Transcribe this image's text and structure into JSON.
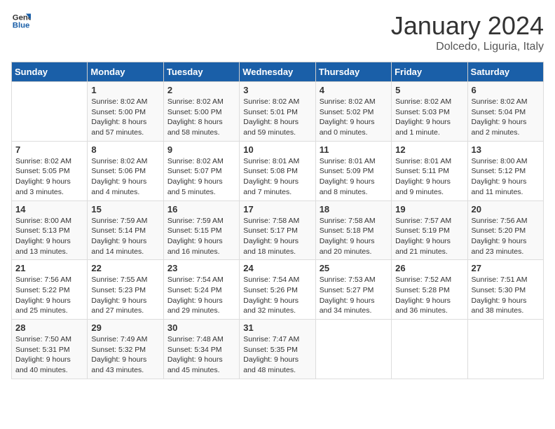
{
  "logo": {
    "line1": "General",
    "line2": "Blue"
  },
  "header": {
    "month": "January 2024",
    "location": "Dolcedo, Liguria, Italy"
  },
  "weekdays": [
    "Sunday",
    "Monday",
    "Tuesday",
    "Wednesday",
    "Thursday",
    "Friday",
    "Saturday"
  ],
  "weeks": [
    [
      {
        "day": "",
        "info": ""
      },
      {
        "day": "1",
        "info": "Sunrise: 8:02 AM\nSunset: 5:00 PM\nDaylight: 8 hours\nand 57 minutes."
      },
      {
        "day": "2",
        "info": "Sunrise: 8:02 AM\nSunset: 5:00 PM\nDaylight: 8 hours\nand 58 minutes."
      },
      {
        "day": "3",
        "info": "Sunrise: 8:02 AM\nSunset: 5:01 PM\nDaylight: 8 hours\nand 59 minutes."
      },
      {
        "day": "4",
        "info": "Sunrise: 8:02 AM\nSunset: 5:02 PM\nDaylight: 9 hours\nand 0 minutes."
      },
      {
        "day": "5",
        "info": "Sunrise: 8:02 AM\nSunset: 5:03 PM\nDaylight: 9 hours\nand 1 minute."
      },
      {
        "day": "6",
        "info": "Sunrise: 8:02 AM\nSunset: 5:04 PM\nDaylight: 9 hours\nand 2 minutes."
      }
    ],
    [
      {
        "day": "7",
        "info": "Sunrise: 8:02 AM\nSunset: 5:05 PM\nDaylight: 9 hours\nand 3 minutes."
      },
      {
        "day": "8",
        "info": "Sunrise: 8:02 AM\nSunset: 5:06 PM\nDaylight: 9 hours\nand 4 minutes."
      },
      {
        "day": "9",
        "info": "Sunrise: 8:02 AM\nSunset: 5:07 PM\nDaylight: 9 hours\nand 5 minutes."
      },
      {
        "day": "10",
        "info": "Sunrise: 8:01 AM\nSunset: 5:08 PM\nDaylight: 9 hours\nand 7 minutes."
      },
      {
        "day": "11",
        "info": "Sunrise: 8:01 AM\nSunset: 5:09 PM\nDaylight: 9 hours\nand 8 minutes."
      },
      {
        "day": "12",
        "info": "Sunrise: 8:01 AM\nSunset: 5:11 PM\nDaylight: 9 hours\nand 9 minutes."
      },
      {
        "day": "13",
        "info": "Sunrise: 8:00 AM\nSunset: 5:12 PM\nDaylight: 9 hours\nand 11 minutes."
      }
    ],
    [
      {
        "day": "14",
        "info": "Sunrise: 8:00 AM\nSunset: 5:13 PM\nDaylight: 9 hours\nand 13 minutes."
      },
      {
        "day": "15",
        "info": "Sunrise: 7:59 AM\nSunset: 5:14 PM\nDaylight: 9 hours\nand 14 minutes."
      },
      {
        "day": "16",
        "info": "Sunrise: 7:59 AM\nSunset: 5:15 PM\nDaylight: 9 hours\nand 16 minutes."
      },
      {
        "day": "17",
        "info": "Sunrise: 7:58 AM\nSunset: 5:17 PM\nDaylight: 9 hours\nand 18 minutes."
      },
      {
        "day": "18",
        "info": "Sunrise: 7:58 AM\nSunset: 5:18 PM\nDaylight: 9 hours\nand 20 minutes."
      },
      {
        "day": "19",
        "info": "Sunrise: 7:57 AM\nSunset: 5:19 PM\nDaylight: 9 hours\nand 21 minutes."
      },
      {
        "day": "20",
        "info": "Sunrise: 7:56 AM\nSunset: 5:20 PM\nDaylight: 9 hours\nand 23 minutes."
      }
    ],
    [
      {
        "day": "21",
        "info": "Sunrise: 7:56 AM\nSunset: 5:22 PM\nDaylight: 9 hours\nand 25 minutes."
      },
      {
        "day": "22",
        "info": "Sunrise: 7:55 AM\nSunset: 5:23 PM\nDaylight: 9 hours\nand 27 minutes."
      },
      {
        "day": "23",
        "info": "Sunrise: 7:54 AM\nSunset: 5:24 PM\nDaylight: 9 hours\nand 29 minutes."
      },
      {
        "day": "24",
        "info": "Sunrise: 7:54 AM\nSunset: 5:26 PM\nDaylight: 9 hours\nand 32 minutes."
      },
      {
        "day": "25",
        "info": "Sunrise: 7:53 AM\nSunset: 5:27 PM\nDaylight: 9 hours\nand 34 minutes."
      },
      {
        "day": "26",
        "info": "Sunrise: 7:52 AM\nSunset: 5:28 PM\nDaylight: 9 hours\nand 36 minutes."
      },
      {
        "day": "27",
        "info": "Sunrise: 7:51 AM\nSunset: 5:30 PM\nDaylight: 9 hours\nand 38 minutes."
      }
    ],
    [
      {
        "day": "28",
        "info": "Sunrise: 7:50 AM\nSunset: 5:31 PM\nDaylight: 9 hours\nand 40 minutes."
      },
      {
        "day": "29",
        "info": "Sunrise: 7:49 AM\nSunset: 5:32 PM\nDaylight: 9 hours\nand 43 minutes."
      },
      {
        "day": "30",
        "info": "Sunrise: 7:48 AM\nSunset: 5:34 PM\nDaylight: 9 hours\nand 45 minutes."
      },
      {
        "day": "31",
        "info": "Sunrise: 7:47 AM\nSunset: 5:35 PM\nDaylight: 9 hours\nand 48 minutes."
      },
      {
        "day": "",
        "info": ""
      },
      {
        "day": "",
        "info": ""
      },
      {
        "day": "",
        "info": ""
      }
    ]
  ]
}
